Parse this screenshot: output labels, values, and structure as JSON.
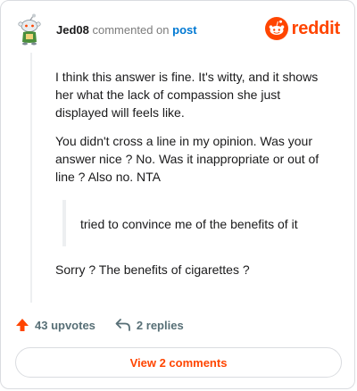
{
  "header": {
    "username": "Jed08",
    "commented_text": "commented on",
    "post_link": "post",
    "brand_name": "reddit",
    "brand_color": "#ff4500",
    "avatar_icon": "snoo-avatar-icon",
    "brand_icon": "reddit-snoo-icon"
  },
  "comment": {
    "paragraph_1": "I think this answer is fine. It's witty, and it shows her what the lack of compassion she just displayed will feels like.",
    "paragraph_2": "You didn't cross a line in my opinion. Was your answer nice ? No. Was it inappropriate or out of line ? Also no. NTA",
    "quote": "tried to convince me of the benefits of it",
    "paragraph_3": "Sorry ? The benefits of cigarettes ?"
  },
  "actions": {
    "upvotes": "43 upvotes",
    "replies": "2 replies",
    "upvote_icon": "upvote-arrow-icon",
    "reply_icon": "reply-arrow-icon"
  },
  "footer": {
    "view_comments": "View 2 comments"
  }
}
